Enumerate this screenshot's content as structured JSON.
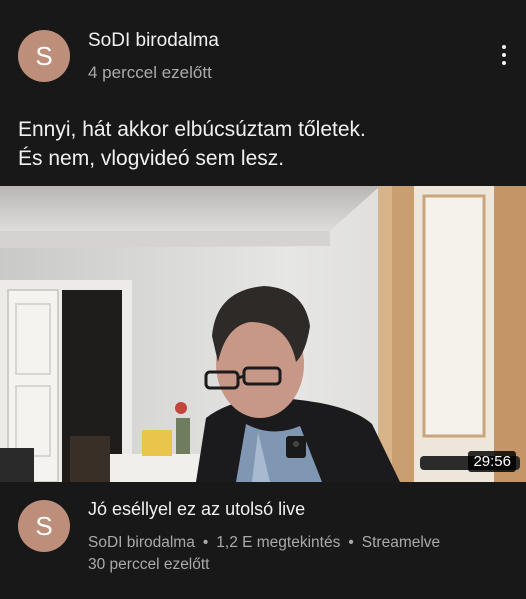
{
  "post": {
    "avatar_letter": "S",
    "channel_name": "SoDI birodalma",
    "time": "4 perccel ezelőtt",
    "text_lines": [
      "Ennyi, hát akkor elbúcsúztam tőletek.",
      "És nem, vlogvideó sem lesz."
    ],
    "more_icon": "more-vertical-icon"
  },
  "video": {
    "duration": "29:56",
    "avatar_letter": "S",
    "title": "Jó eséllyel ez az utolsó live",
    "channel": "SoDI birodalma",
    "separator": "•",
    "views": "1,2 E megtekintés",
    "status": "Streamelve",
    "time": "30 perccel ezelőtt"
  },
  "colors": {
    "background": "#181818",
    "avatar": "#bd8f7a",
    "primary_text": "#f1f1f1",
    "secondary_text": "#aaaaaa"
  }
}
